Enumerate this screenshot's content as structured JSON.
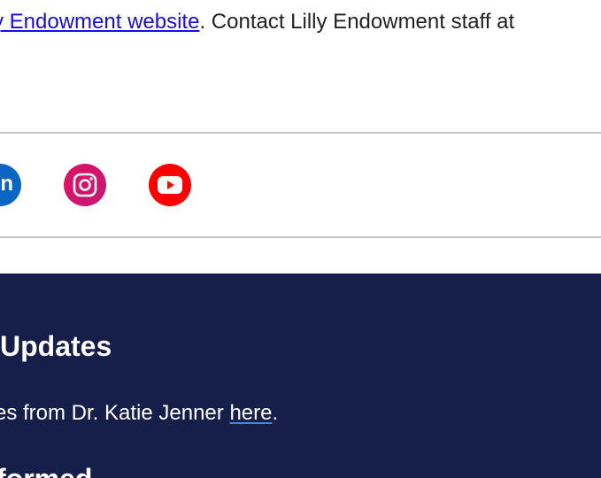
{
  "intro": {
    "link_text": "y Endowment website",
    "after_text": ". Contact Lilly Endowment staff at"
  },
  "social": {
    "linkedin_glyph": "in",
    "icons": [
      "linkedin-icon",
      "instagram-icon",
      "youtube-icon"
    ],
    "colors": {
      "linkedin": "#0a66c2",
      "instagram": "#e0115f",
      "youtube": "#ff0000"
    }
  },
  "footer": {
    "background": "#161e4a",
    "heading": "Updates",
    "text_before": "es from Dr. Katie Jenner ",
    "link_text": "here",
    "text_after": ".",
    "heading_2": "formed"
  }
}
